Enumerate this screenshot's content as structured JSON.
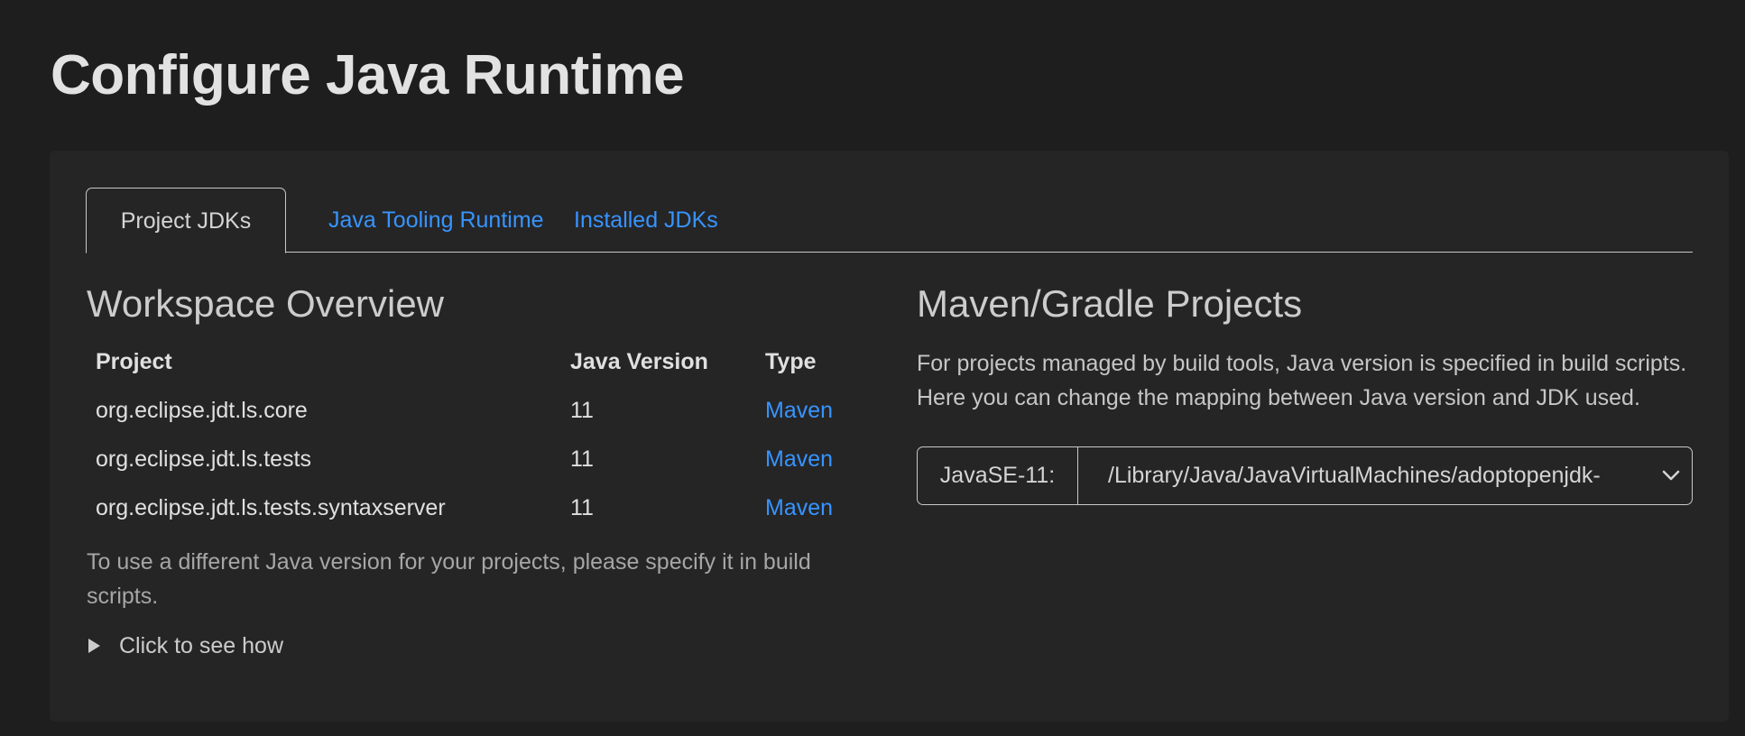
{
  "page": {
    "title": "Configure Java Runtime"
  },
  "tabs": [
    {
      "label": "Project JDKs",
      "active": true
    },
    {
      "label": "Java Tooling Runtime",
      "active": false
    },
    {
      "label": "Installed JDKs",
      "active": false
    }
  ],
  "workspace": {
    "title": "Workspace Overview",
    "columns": [
      "Project",
      "Java Version",
      "Type"
    ],
    "rows": [
      {
        "project": "org.eclipse.jdt.ls.core",
        "version": "11",
        "type": "Maven"
      },
      {
        "project": "org.eclipse.jdt.ls.tests",
        "version": "11",
        "type": "Maven"
      },
      {
        "project": "org.eclipse.jdt.ls.tests.syntaxserver",
        "version": "11",
        "type": "Maven"
      }
    ],
    "note": "To use a different Java version for your projects, please specify it in build scripts.",
    "details_label": "Click to see how"
  },
  "build_projects": {
    "title": "Maven/Gradle Projects",
    "description": "For projects managed by build tools, Java version is specified in build scripts. Here you can change the mapping between Java version and JDK used.",
    "mapping": {
      "label": "JavaSE-11:",
      "selected_value": "/Library/Java/JavaVirtualMachines/adoptopenjdk-"
    }
  },
  "colors": {
    "background": "#1e1e1e",
    "panel": "#252526",
    "link": "#3794ff",
    "border": "#c8c8c8"
  },
  "icons": {
    "details_toggle": "triangle-right-icon",
    "select_arrow": "chevron-down-icon"
  }
}
